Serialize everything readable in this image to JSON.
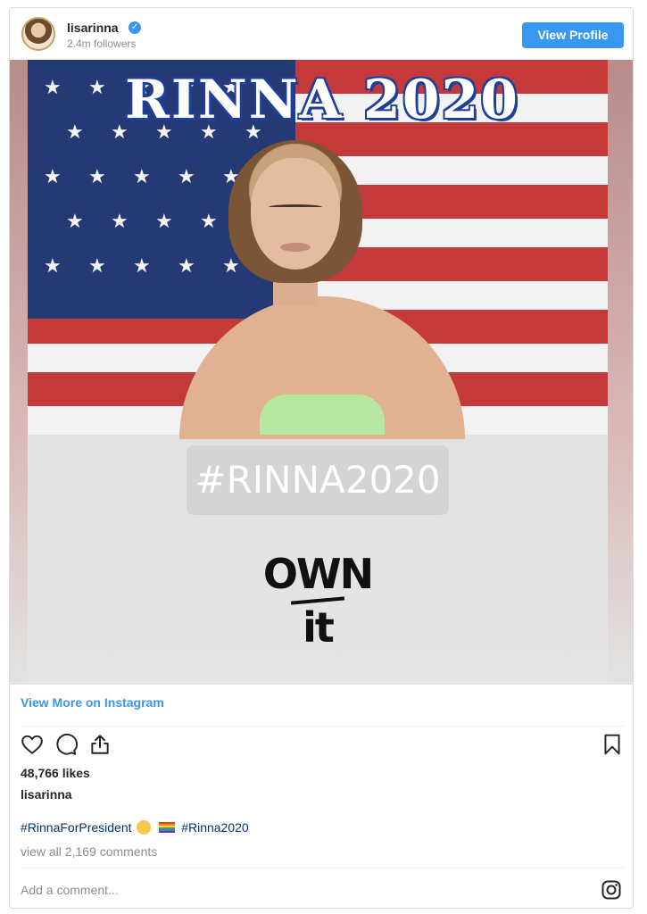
{
  "header": {
    "username": "lisarinna",
    "followers": "2.4m followers",
    "view_profile_label": "View Profile"
  },
  "media": {
    "headline": "RINNA 2020",
    "hashtag": "#RINNA2020",
    "slogan_line1": "OWN",
    "slogan_line2": "it"
  },
  "footer": {
    "view_more_label": "View More on Instagram",
    "likes": "48,766 likes",
    "author": "lisarinna",
    "caption_tag1": "#RinnaForPresident",
    "caption_tag2": "#Rinna2020",
    "view_all_comments": "view all 2,169 comments",
    "add_comment_placeholder": "Add a comment..."
  },
  "icons": {
    "like": "heart-icon",
    "comment": "comment-icon",
    "share": "share-icon",
    "save": "bookmark-icon",
    "instagram": "instagram-icon",
    "verified": "verified-badge-icon"
  },
  "colors": {
    "accent_blue": "#3897f0",
    "text_dark": "#262626",
    "muted_gray": "#8e8e8e",
    "link_navy": "#003569"
  }
}
